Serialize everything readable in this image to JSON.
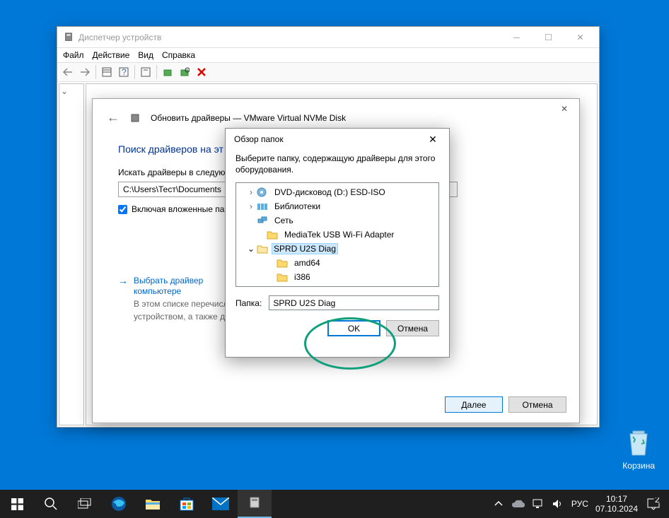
{
  "devmgr": {
    "title": "Диспетчер устройств",
    "menu": {
      "file": "Файл",
      "action": "Действие",
      "view": "Вид",
      "help": "Справка"
    }
  },
  "wizard": {
    "title": "Обновить драйверы — VMware Virtual NVMe Disk",
    "section_title": "Поиск драйверов на эт",
    "search_label": "Искать драйверы в следующе",
    "path_value": "C:\\Users\\Тест\\Documents",
    "checkbox_label": "Включая вложенные папки",
    "link_title": "Выбрать драйвер",
    "link_sub": "компьютере",
    "link_desc1": "В этом списке перечисл",
    "link_desc2": "устройством, а также др",
    "btn_next": "Далее",
    "btn_cancel": "Отмена"
  },
  "browse": {
    "title": "Обзор папок",
    "instruction": "Выберите папку, содержащую драйверы для этого оборудования.",
    "folder_label": "Папка:",
    "folder_value": "SPRD U2S Diag",
    "btn_ok": "OK",
    "btn_cancel": "Отмена",
    "tree": {
      "dvd": "DVD-дисковод (D:) ESD-ISO",
      "libs": "Библиотеки",
      "network": "Сеть",
      "mediatek": "MediaTek USB Wi-Fi Adapter",
      "sprd": "SPRD U2S Diag",
      "amd64": "amd64",
      "i386": "i386"
    }
  },
  "desktop": {
    "recycle_bin": "Корзина"
  },
  "taskbar": {
    "lang": "РУС",
    "time": "10:17",
    "date": "07.10.2024"
  }
}
